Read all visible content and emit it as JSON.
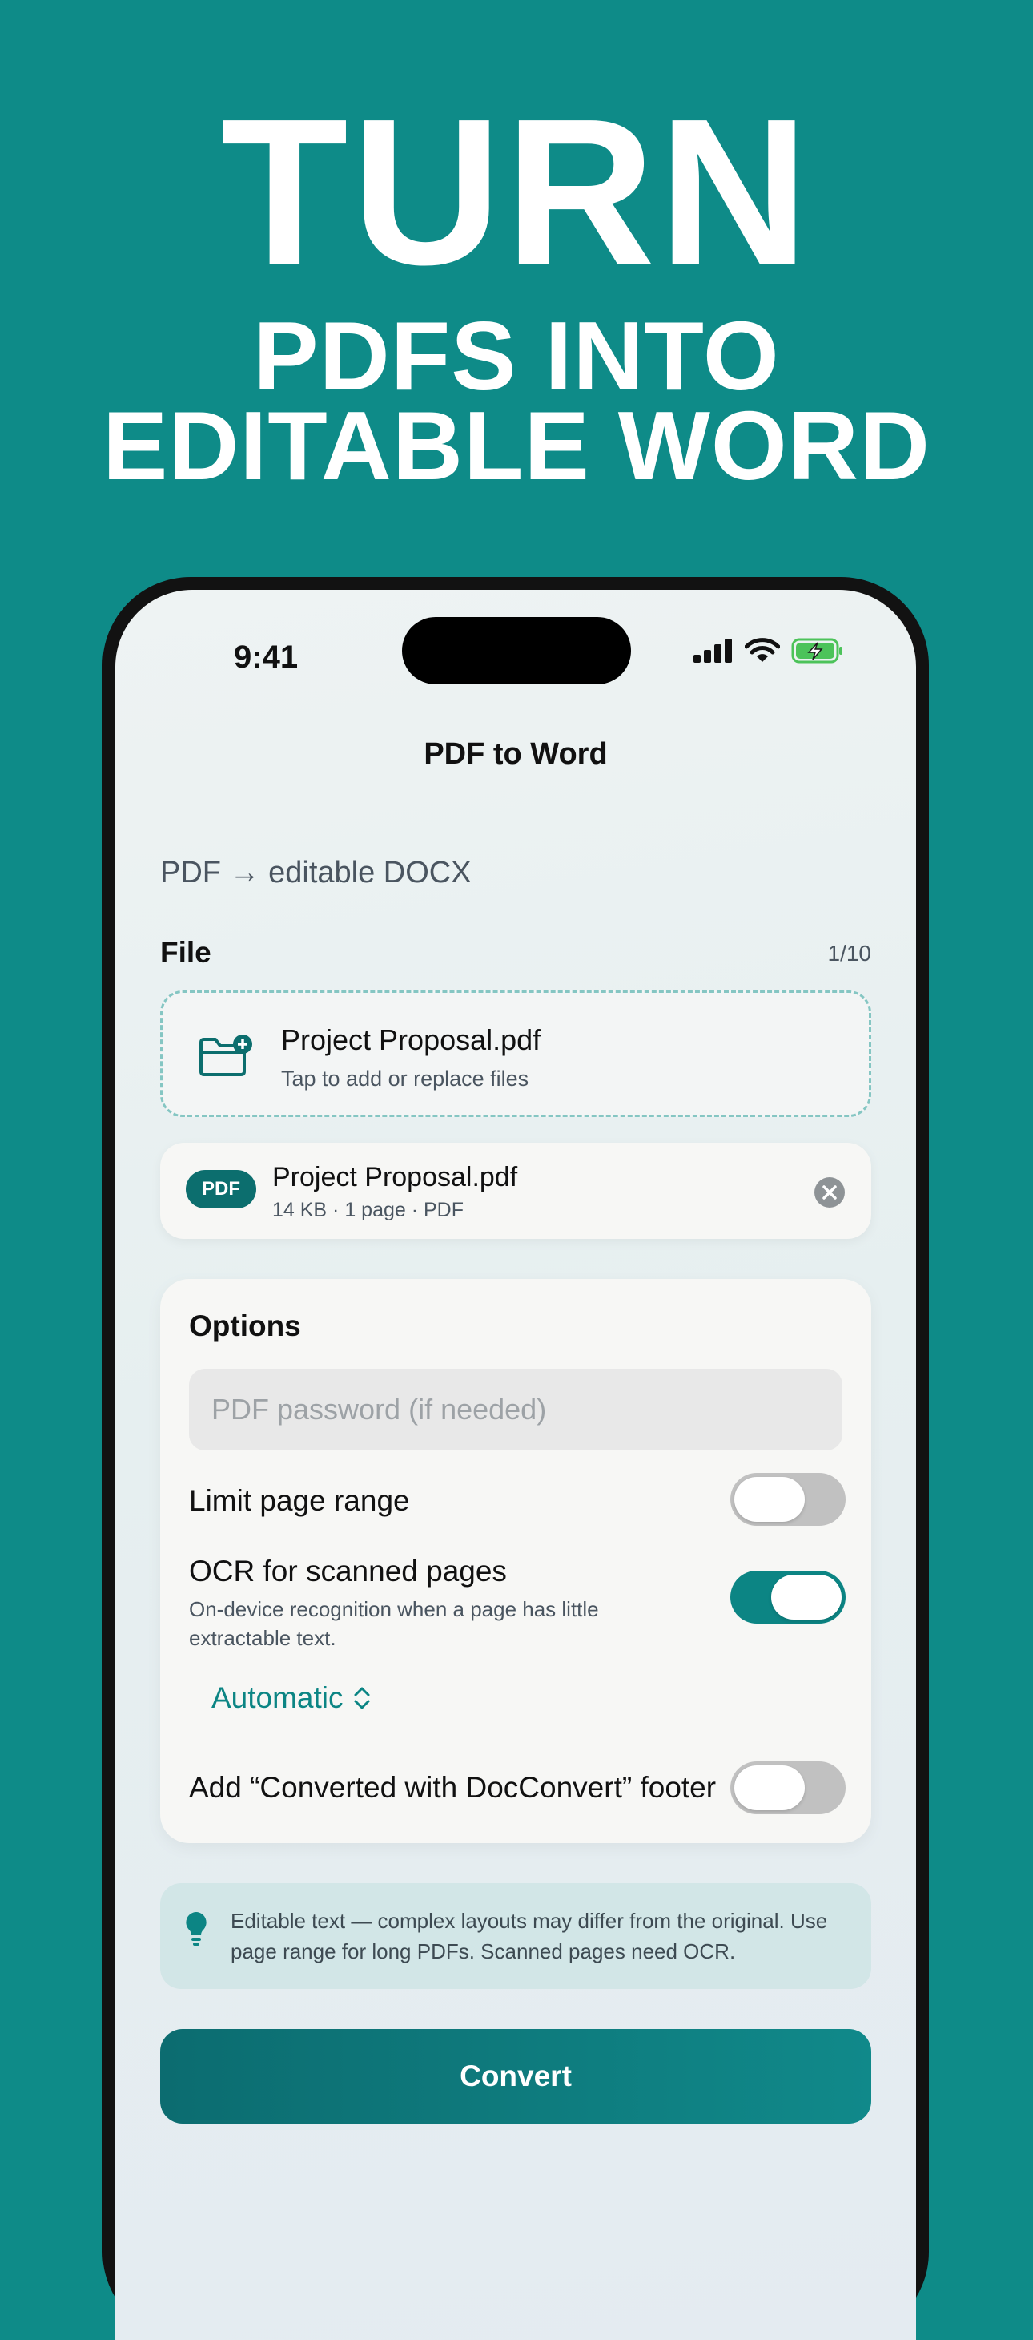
{
  "hero": {
    "line1": "TURN",
    "line2": "PDFS INTO",
    "line3": "EDITABLE WORD"
  },
  "status_bar": {
    "time": "9:41",
    "icons": [
      "signal-icon",
      "wifi-icon",
      "battery-charging-icon"
    ]
  },
  "nav": {
    "title": "PDF to Word"
  },
  "subtitle": "PDF → editable DOCX",
  "file_section": {
    "heading": "File",
    "count": "1/10",
    "dropzone": {
      "title": "Project Proposal.pdf",
      "hint": "Tap to add or replace files",
      "icon": "folder-add-icon"
    },
    "file": {
      "badge": "PDF",
      "name": "Project Proposal.pdf",
      "meta": "14 KB · 1 page · PDF",
      "remove_icon": "close-circle-icon"
    }
  },
  "options": {
    "heading": "Options",
    "password_placeholder": "PDF password (if needed)",
    "page_range": {
      "label": "Limit page range",
      "enabled": false
    },
    "ocr": {
      "label": "OCR for scanned pages",
      "description": "On-device recognition when a page has little extractable text.",
      "enabled": true,
      "mode": "Automatic"
    },
    "footer": {
      "label": "Add “Converted with DocConvert” footer",
      "enabled": false
    }
  },
  "tip": {
    "icon": "lightbulb-icon",
    "text": "Editable text — complex layouts may differ from the original. Use page range for long PDFs. Scanned pages need OCR."
  },
  "convert_label": "Convert",
  "colors": {
    "background": "#0e8b88",
    "accent": "#0c8584",
    "toggle_off": "#c1c1c1"
  }
}
